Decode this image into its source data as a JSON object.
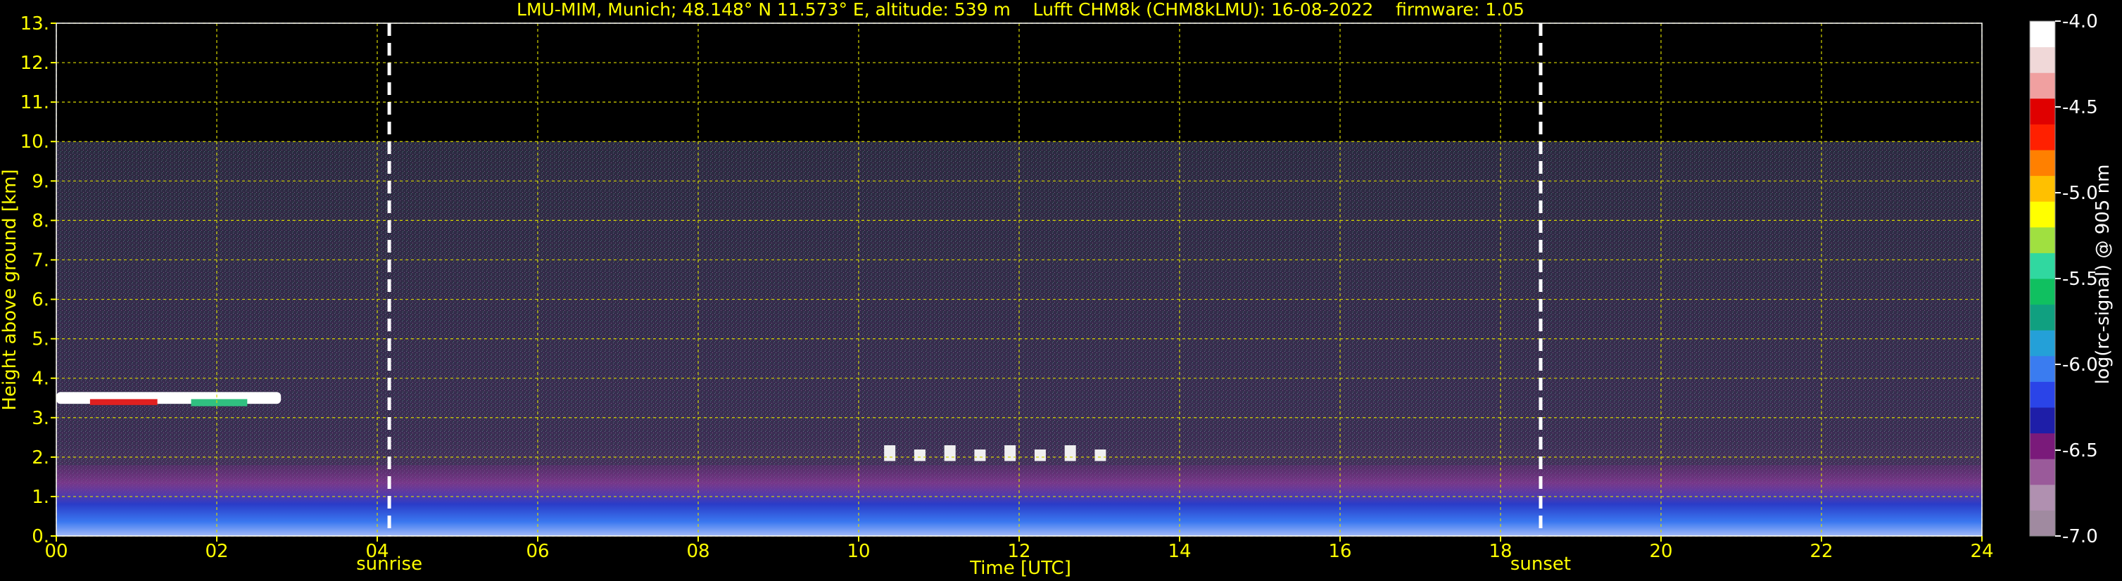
{
  "chart_data": {
    "type": "heatmap",
    "title": "LMU-MIM, Munich; 48.148° N 11.573° E, altitude: 539 m    Lufft CHM8k (CHM8kLMU): 16-08-2022    firmware: 1.05",
    "xlabel": "Time [UTC]",
    "ylabel": "Height above ground [km]",
    "xlim": [
      0,
      24
    ],
    "ylim": [
      0,
      13
    ],
    "x_ticks": [
      "00",
      "02",
      "04",
      "06",
      "08",
      "10",
      "12",
      "14",
      "16",
      "18",
      "20",
      "22",
      "24"
    ],
    "y_ticks": [
      "0.",
      "1.",
      "2.",
      "3.",
      "4.",
      "5.",
      "6.",
      "7.",
      "8.",
      "9.",
      "10.",
      "11.",
      "12.",
      "13."
    ],
    "grid": true,
    "data_top_km": 10.0,
    "markers": [
      {
        "label": "sunrise",
        "x": 4.15
      },
      {
        "label": "sunset",
        "x": 18.5
      }
    ],
    "colorbar": {
      "label": "log(rc-signal) @ 905 nm",
      "range": [
        -7.0,
        -4.0
      ],
      "ticks": [
        "-4.0",
        "-4.5",
        "-5.0",
        "-5.5",
        "-6.0",
        "-6.5",
        "-7.0"
      ],
      "colors": [
        "#a08aa0",
        "#b090b0",
        "#9a5a9a",
        "#7a1a7a",
        "#1e1ea8",
        "#2a44e8",
        "#3a7cf0",
        "#24a0d8",
        "#10a080",
        "#10c060",
        "#30d8a0",
        "#a0e040",
        "#ffff00",
        "#ffc000",
        "#ff8000",
        "#ff2000",
        "#e00000",
        "#f0a0a0",
        "#f0d8d8",
        "#ffffff"
      ]
    },
    "features": [
      {
        "name": "cloud layer",
        "x_start": 0.0,
        "x_end": 2.8,
        "y_bottom": 3.2,
        "y_top": 3.8
      },
      {
        "name": "boundary layer",
        "x_start": 0.0,
        "x_end": 24.0,
        "y_bottom": 0.0,
        "y_top": 1.8
      },
      {
        "name": "scattered clouds",
        "x_start": 10.2,
        "x_end": 13.2,
        "y_bottom": 1.9,
        "y_top": 2.3
      }
    ]
  }
}
